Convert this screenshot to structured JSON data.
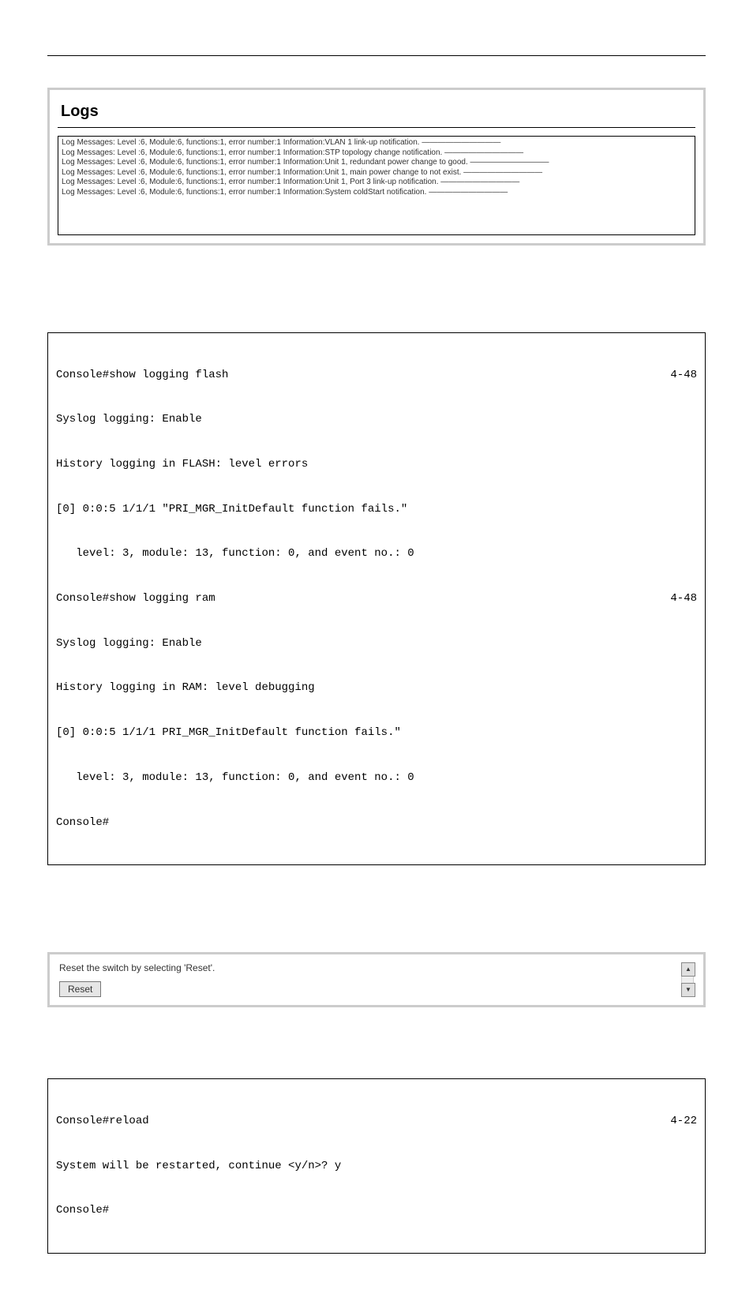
{
  "logs_panel": {
    "title": "Logs",
    "entries": [
      "Log Messages: Level :6, Module:6, functions:1, error number:1 Information:VLAN 1 link-up notification. ——————————",
      "Log Messages: Level :6, Module:6, functions:1, error number:1 Information:STP topology change notification. ——————————",
      "Log Messages: Level :6, Module:6, functions:1, error number:1 Information:Unit 1, redundant power change to good. ——————————",
      "Log Messages: Level :6, Module:6, functions:1, error number:1 Information:Unit 1, main power change to not exist. ——————————",
      "Log Messages: Level :6, Module:6, functions:1, error number:1 Information:Unit 1, Port 3 link-up notification. ——————————",
      "Log Messages: Level :6, Module:6, functions:1, error number:1 Information:System coldStart notification. ——————————"
    ]
  },
  "cli_block_1": {
    "lines": [
      {
        "text": "Console#show logging flash",
        "ref": "4-48"
      },
      {
        "text": "Syslog logging: Enable"
      },
      {
        "text": "History logging in FLASH: level errors"
      },
      {
        "text": "[0] 0:0:5 1/1/1 \"PRI_MGR_InitDefault function fails.\""
      },
      {
        "text": "   level: 3, module: 13, function: 0, and event no.: 0"
      },
      {
        "text": "Console#show logging ram",
        "ref": "4-48"
      },
      {
        "text": "Syslog logging: Enable"
      },
      {
        "text": "History logging in RAM: level debugging"
      },
      {
        "text": "[0] 0:0:5 1/1/1 PRI_MGR_InitDefault function fails.\""
      },
      {
        "text": "   level: 3, module: 13, function: 0, and event no.: 0"
      },
      {
        "text": "Console#"
      }
    ]
  },
  "reset_panel": {
    "instruction": "Reset the switch by selecting 'Reset'.",
    "button_label": "Reset"
  },
  "cli_block_2": {
    "lines": [
      {
        "text": "Console#reload",
        "ref": "4-22"
      },
      {
        "text": "System will be restarted, continue <y/n>? y"
      },
      {
        "text": "Console#"
      }
    ]
  }
}
